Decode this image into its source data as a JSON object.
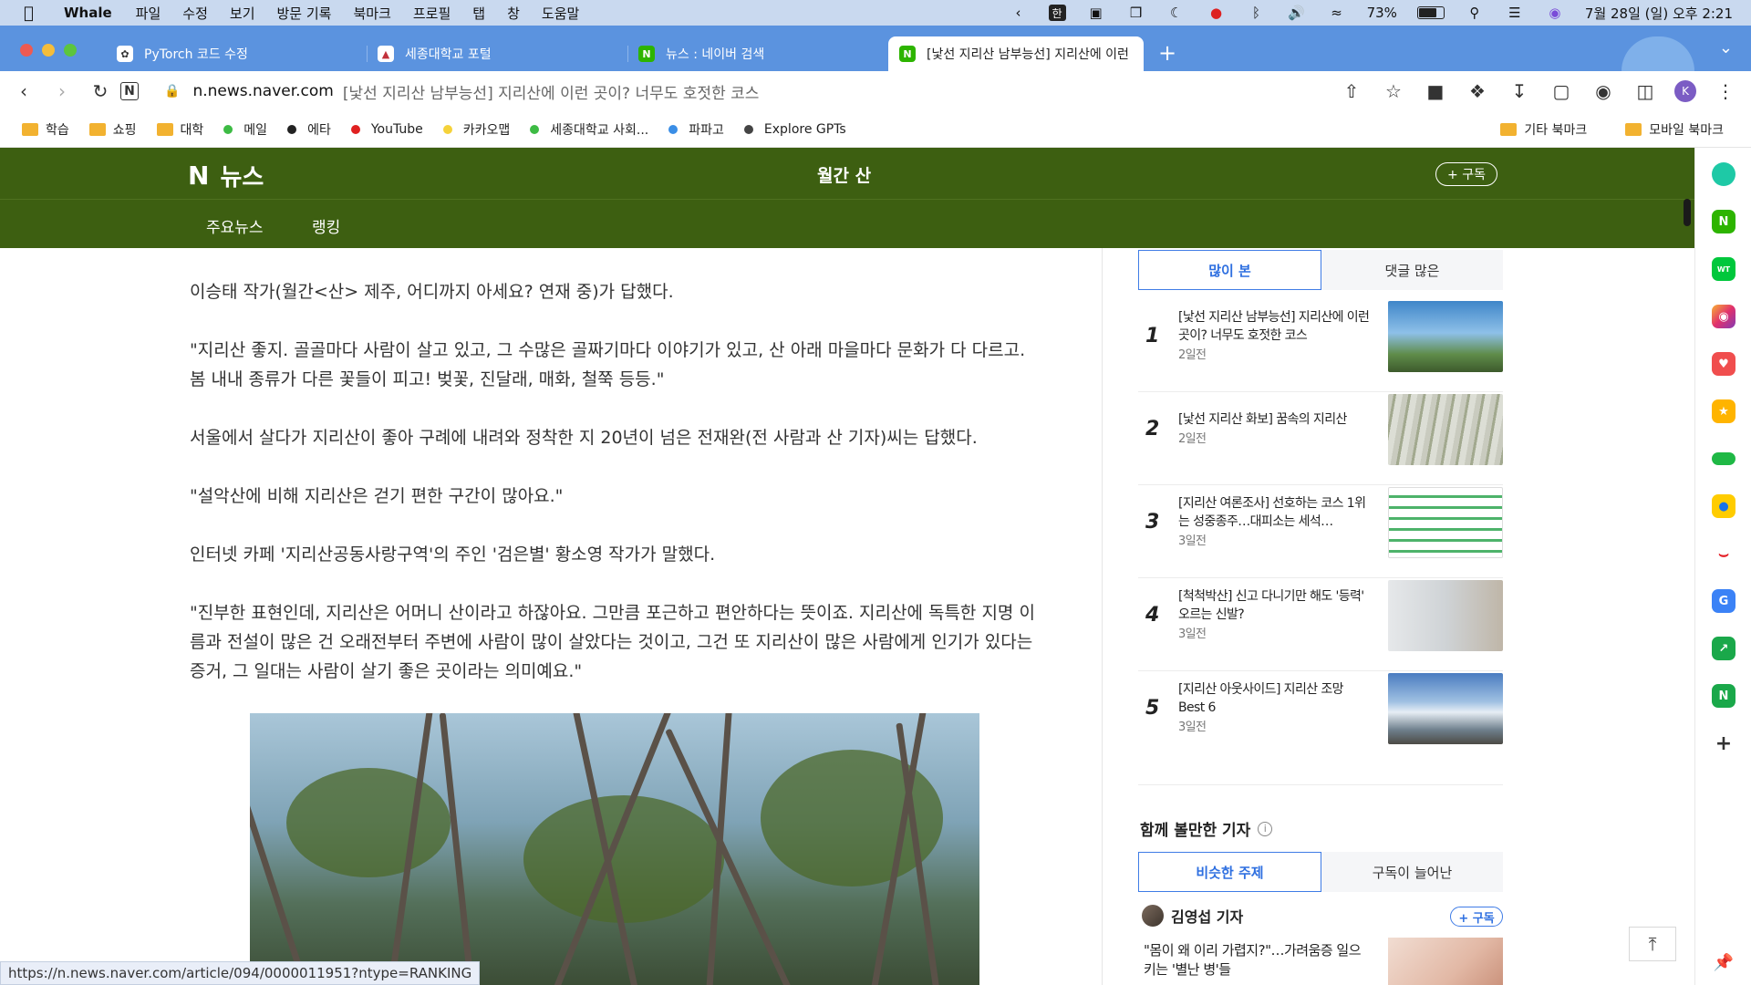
{
  "menubar": {
    "app_name": "Whale",
    "items": [
      "파일",
      "수정",
      "보기",
      "방문 기록",
      "북마크",
      "프로필",
      "탭",
      "창",
      "도움말"
    ],
    "input_lang": "한",
    "battery_text": "73%",
    "battery_level": 0.73,
    "clock": "7월 28일 (일) 오후 2:21"
  },
  "tabs": [
    {
      "title": "PyTorch 코드 수정",
      "icon": "openai-icon"
    },
    {
      "title": "세종대학교 포털",
      "icon": "sejong-icon"
    },
    {
      "title": "뉴스 : 네이버 검색",
      "icon": "naver-icon"
    },
    {
      "title": "[낯선 지리산 남부능선] 지리산에 이런",
      "icon": "naver-icon",
      "active": true
    }
  ],
  "toolbar": {
    "domain": "n.news.naver.com",
    "page_title": "[낯선 지리산 남부능선] 지리산에 이런 곳이? 너무도 호젓한 코스",
    "profile_initial": "K"
  },
  "bookmarks": {
    "items": [
      {
        "label": "학습",
        "type": "folder"
      },
      {
        "label": "쇼핑",
        "type": "folder"
      },
      {
        "label": "대학",
        "type": "folder"
      },
      {
        "label": "메일",
        "type": "dot",
        "color": "#3dbb44"
      },
      {
        "label": "에타",
        "type": "dot",
        "color": "#222222"
      },
      {
        "label": "YouTube",
        "type": "dot",
        "color": "#e02020"
      },
      {
        "label": "카카오맵",
        "type": "dot",
        "color": "#f5d23a"
      },
      {
        "label": "세종대학교 사회...",
        "type": "dot",
        "color": "#3dbb44"
      },
      {
        "label": "파파고",
        "type": "dot",
        "color": "#3a8ee6"
      },
      {
        "label": "Explore GPTs",
        "type": "dot",
        "color": "#444444"
      }
    ],
    "right_items": [
      "기타 북마크",
      "모바일 북마크"
    ]
  },
  "news_header": {
    "logo_mark": "N",
    "logo_text": "뉴스",
    "press_name": "월간 산",
    "subscribe_label": "+ 구독",
    "nav": [
      "주요뉴스",
      "랭킹"
    ]
  },
  "article": {
    "paragraphs": [
      "이승태 작가(월간<산> 제주, 어디까지 아세요? 연재 중)가 답했다.",
      "\"지리산 좋지. 골골마다 사람이 살고 있고, 그 수많은 골짜기마다 이야기가 있고, 산 아래 마을마다 문화가 다 다르고. 봄 내내 종류가 다른 꽃들이 피고! 벚꽃, 진달래, 매화, 철쭉 등등.\"",
      "서울에서 살다가 지리산이 좋아 구례에 내려와 정착한 지 20년이 넘은 전재완(전 사람과 산 기자)씨는 답했다.",
      "\"설악산에 비해 지리산은 걷기 편한 구간이 많아요.\"",
      "인터넷 카페 '지리산공동사랑구역'의 주인 '검은별' 황소영 작가가 말했다.",
      "\"진부한 표현인데, 지리산은 어머니 산이라고 하잖아요. 그만큼 포근하고 편안하다는 뜻이죠. 지리산에 독특한 지명 이름과 전설이 많은 건 오래전부터 주변에 사람이 많이 살았다는 것이고, 그건 또 지리산이 많은 사람에게 인기가 있다는 증거, 그 일대는 사람이 살기 좋은 곳이라는 의미예요.\""
    ]
  },
  "status_url": "https://n.news.naver.com/article/094/0000011951?ntype=RANKING",
  "ranking": {
    "tabs": [
      "많이 본",
      "댓글 많은"
    ],
    "items": [
      {
        "rank": "1",
        "title": "[낯선 지리산 남부능선] 지리산에 이런 곳이? 너무도 호젓한 코스",
        "time": "2일전"
      },
      {
        "rank": "2",
        "title": "[낯선 지리산 화보] 꿈속의 지리산",
        "time": "2일전"
      },
      {
        "rank": "3",
        "title": "[지리산 여론조사] 선호하는 코스 1위는 성중종주…대피소는 세석…",
        "time": "3일전"
      },
      {
        "rank": "4",
        "title": "[척척박산] 신고 다니기만 해도 '등력' 오르는 신발?",
        "time": "3일전"
      },
      {
        "rank": "5",
        "title": "[지리산 아웃사이드] 지리산 조망 Best 6",
        "time": "3일전"
      }
    ]
  },
  "together": {
    "title": "함께 볼만한 기자",
    "tabs": [
      "비슷한 주제",
      "구독이 늘어난"
    ],
    "reporter_name": "김영섭 기자",
    "subscribe_label": "+ 구독",
    "article_title": "\"몸이 왜 이리 가렵지?\"…가려움증 일으키는 '별난 병'들"
  }
}
